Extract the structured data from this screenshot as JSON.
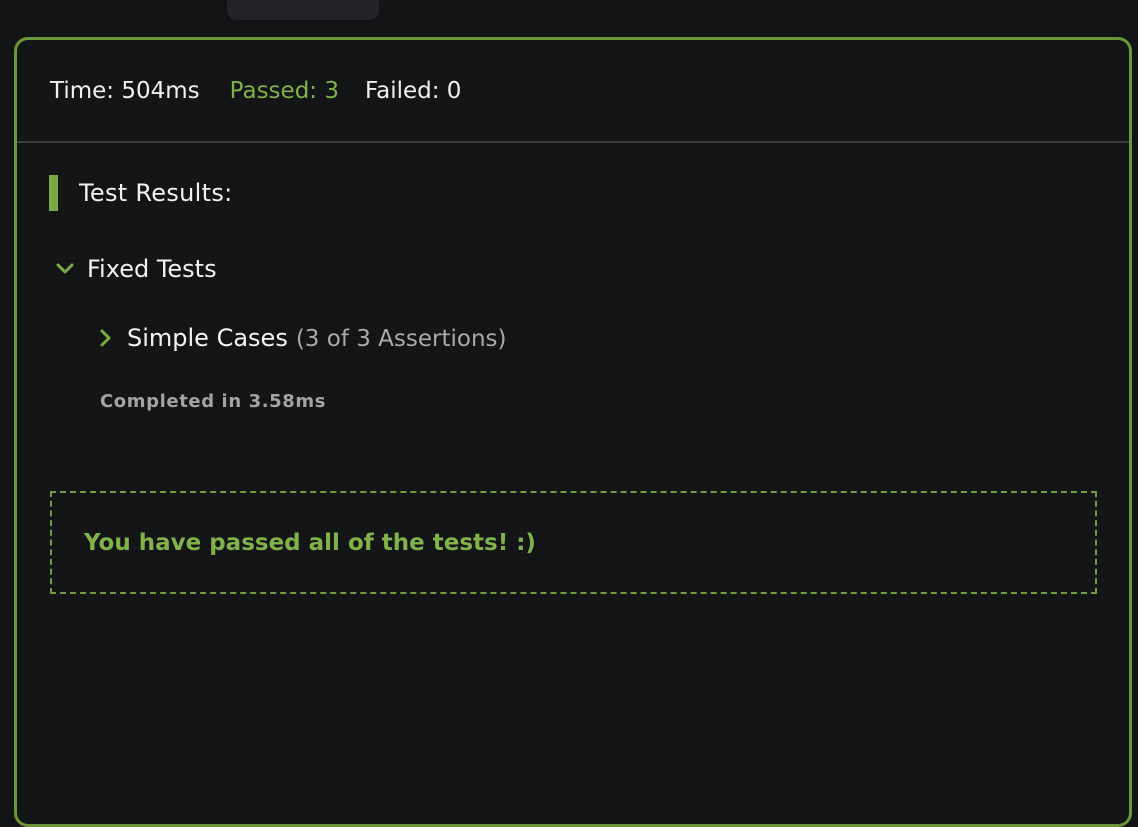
{
  "stats": {
    "time": "Time: 504ms",
    "passed": "Passed: 3",
    "failed": "Failed: 0"
  },
  "results": {
    "heading": "Test Results:",
    "group": {
      "label": "Fixed Tests",
      "icon": "chevron-down-icon",
      "case": {
        "label": "Simple Cases",
        "count": "(3 of 3 Assertions)",
        "icon": "chevron-right-icon"
      },
      "completed": "Completed in 3.58ms"
    },
    "banner": "You have passed all of the tests! :)"
  },
  "colors": {
    "accent": "#78ab43",
    "pass_text": "#7fb249",
    "background": "#131415",
    "border": "#6a9539"
  }
}
